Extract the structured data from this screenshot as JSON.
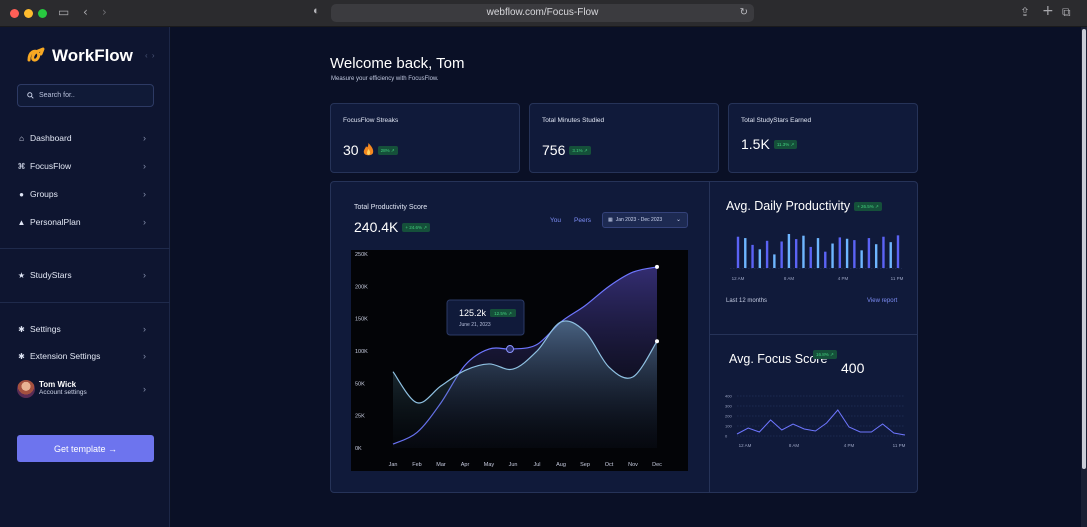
{
  "browser": {
    "url": "webflow.com/Focus-Flow"
  },
  "sidebar": {
    "brand": "WorkFlow",
    "search_placeholder": "Search for..",
    "nav": [
      {
        "label": "Dashboard",
        "icon": "home-icon"
      },
      {
        "label": "FocusFlow",
        "icon": "focus-icon"
      },
      {
        "label": "Groups",
        "icon": "user-icon"
      },
      {
        "label": "PersonalPlan",
        "icon": "plan-icon"
      },
      {
        "label": "StudyStars",
        "icon": "star-icon"
      },
      {
        "label": "Settings",
        "icon": "gear-icon"
      },
      {
        "label": "Extension Settings",
        "icon": "gear-icon"
      }
    ],
    "user": {
      "name": "Tom Wick",
      "subtitle": "Account settings"
    },
    "cta": "Get template →"
  },
  "header": {
    "title": "Welcome back, Tom",
    "subtitle": "Measure your efficiency with FocusFlow."
  },
  "stats": [
    {
      "title": "FocusFlow Streaks",
      "value": "30",
      "badge": "28% ↗",
      "icon": "flame-icon"
    },
    {
      "title": "Total Minutes Studied",
      "value": "756",
      "badge": "3.1% ↗"
    },
    {
      "title": "Total StudyStars Earned",
      "value": "1.5K",
      "badge": "11.3% ↗"
    }
  ],
  "productivity": {
    "title": "Total Productivity Score",
    "value": "240.4K",
    "badge": "+ 24.6% ↗",
    "toggle_you": "You",
    "toggle_peers": "Peers",
    "date_range": "Jan 2023 - Dec 2023",
    "tooltip": {
      "value": "125.2k",
      "badge": "12.5% ↗",
      "date": "June 21, 2023"
    }
  },
  "daily": {
    "title": "Avg. Daily Productivity",
    "badge": "+ 26.5% ↗",
    "footer": "Last 12 months",
    "link": "View report",
    "x_labels": [
      "12 AM",
      "8 AM",
      "4 PM",
      "11 PM"
    ]
  },
  "focus": {
    "title": "Avg. Focus Score",
    "badge": "16.8% ↗",
    "value": "400",
    "x_labels": [
      "12 AM",
      "8 AM",
      "4 PM",
      "11 PM"
    ],
    "y_labels": [
      "400",
      "300",
      "200",
      "100",
      "0"
    ]
  },
  "chart_data": [
    {
      "type": "area",
      "title": "Total Productivity Score",
      "categories": [
        "Jan",
        "Feb",
        "Mar",
        "Apr",
        "May",
        "Jun",
        "Jul",
        "Aug",
        "Sep",
        "Oct",
        "Nov",
        "Dec"
      ],
      "y_tick_labels": [
        "250K",
        "200K",
        "150K",
        "100K",
        "50K",
        "25K",
        "0K"
      ],
      "ylim": [
        0,
        250000
      ],
      "grid": false,
      "series": [
        {
          "name": "You",
          "color": "#6e76ff",
          "values": [
            3000,
            12000,
            35000,
            78000,
            103000,
            103000,
            110000,
            145000,
            170000,
            200000,
            222000,
            230000
          ]
        },
        {
          "name": "Peers",
          "color": "#8fc1e2",
          "values": [
            68000,
            35000,
            48000,
            70000,
            80000,
            72000,
            100000,
            145000,
            130000,
            75000,
            60000,
            115000
          ]
        }
      ]
    },
    {
      "type": "bar",
      "title": "Avg. Daily Productivity",
      "x_tick_labels": [
        "12 AM",
        "8 AM",
        "4 PM",
        "11 PM"
      ],
      "values": [
        92,
        88,
        68,
        55,
        80,
        40,
        78,
        100,
        85,
        95,
        62,
        88,
        48,
        72,
        90,
        86,
        82,
        52,
        88,
        70,
        92,
        76,
        96
      ],
      "colors": [
        "#5b63f5",
        "#6eb6ff"
      ]
    },
    {
      "type": "line",
      "title": "Avg. Focus Score",
      "x_tick_labels": [
        "12 AM",
        "8 AM",
        "4 PM",
        "11 PM"
      ],
      "y_tick_labels": [
        "400",
        "300",
        "200",
        "100",
        "0"
      ],
      "ylim": [
        0,
        400
      ],
      "values": [
        20,
        80,
        40,
        160,
        60,
        120,
        70,
        50,
        130,
        260,
        90,
        40,
        40,
        120,
        30,
        10
      ],
      "color": "#6e76ff"
    }
  ]
}
